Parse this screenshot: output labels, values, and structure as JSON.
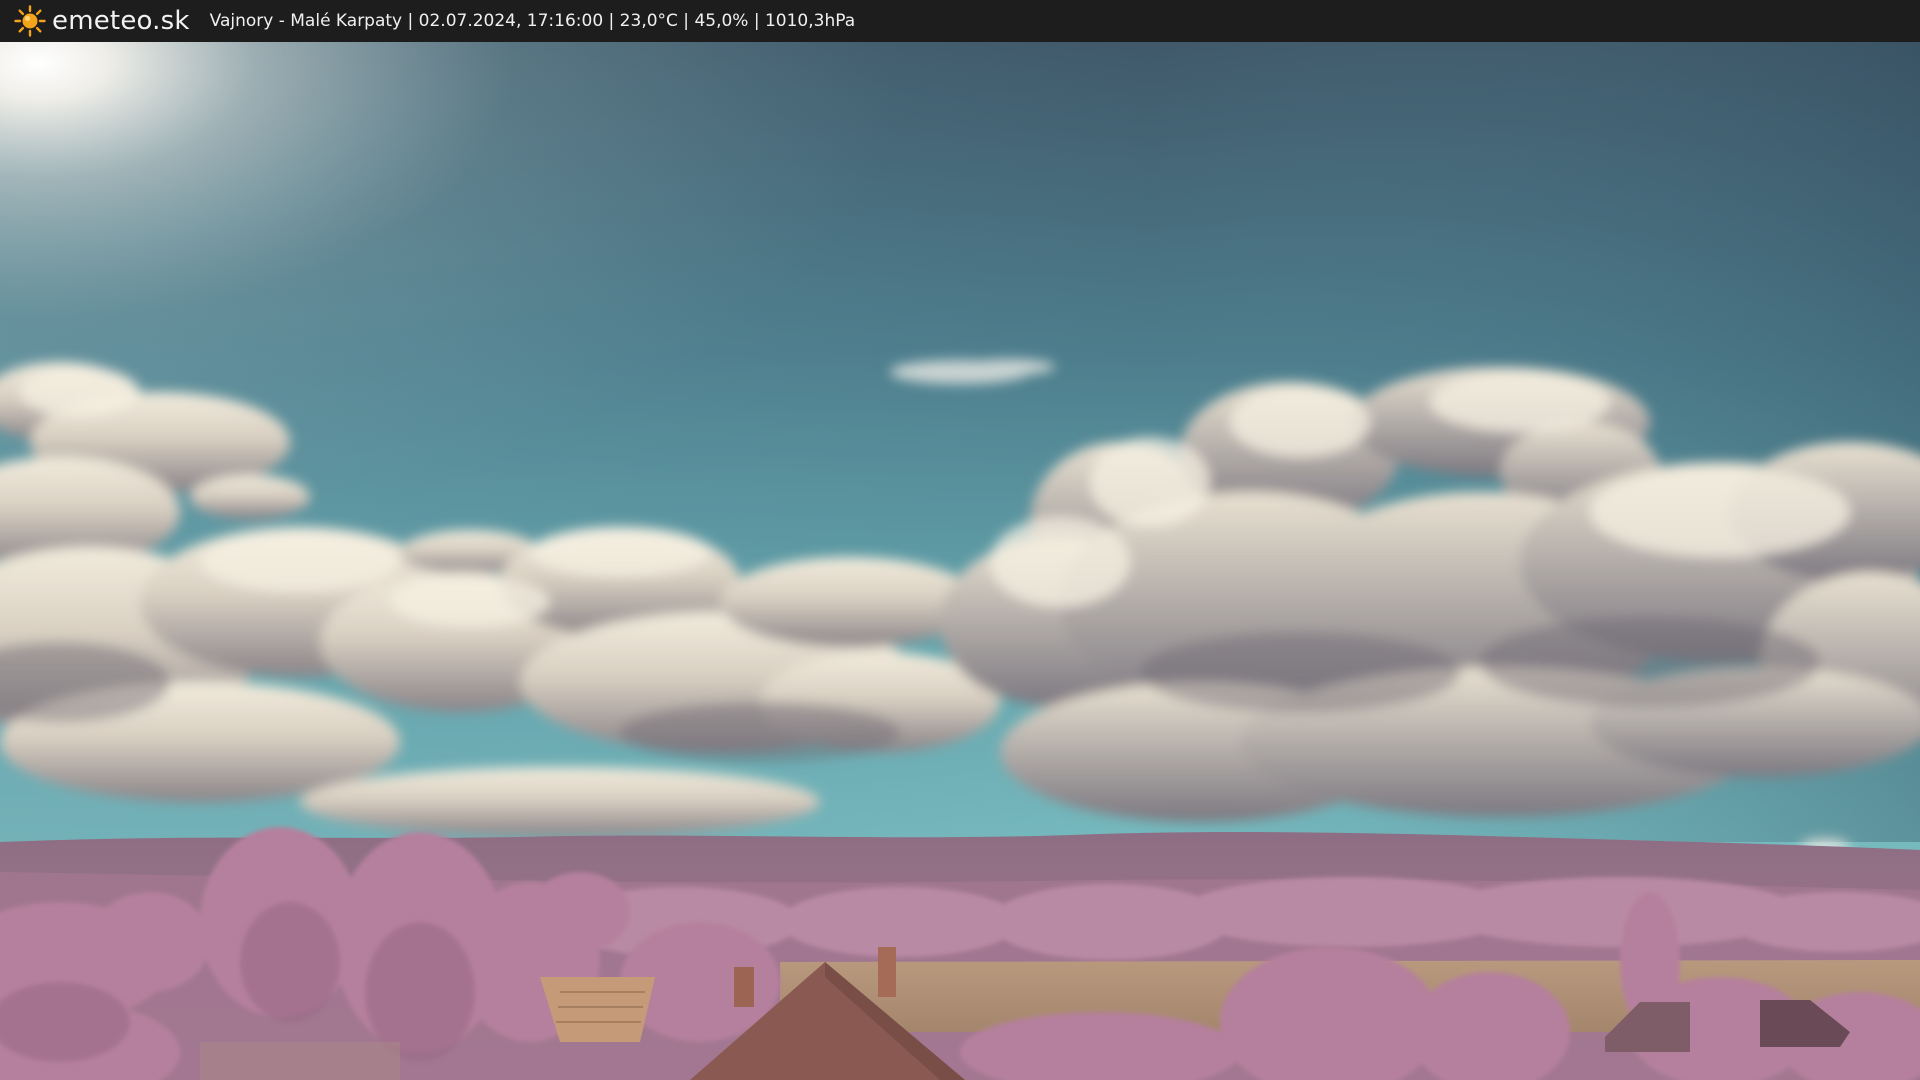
{
  "header": {
    "logo_text": "emeteo.sk",
    "logo_icon": "sun-icon",
    "caption": "Vajnory - Malé Karpaty | 02.07.2024, 17:16:00 | 23,0°C | 45,0% | 1010,3hPa"
  },
  "colors": {
    "topbar_bg": "#1d1d1d",
    "sun_icon": "#f4a41a",
    "sky_top": "#3f5a6c",
    "sky_horizon": "#6fb3b8",
    "foliage": "#b77e9c",
    "field": "#b9997e"
  }
}
